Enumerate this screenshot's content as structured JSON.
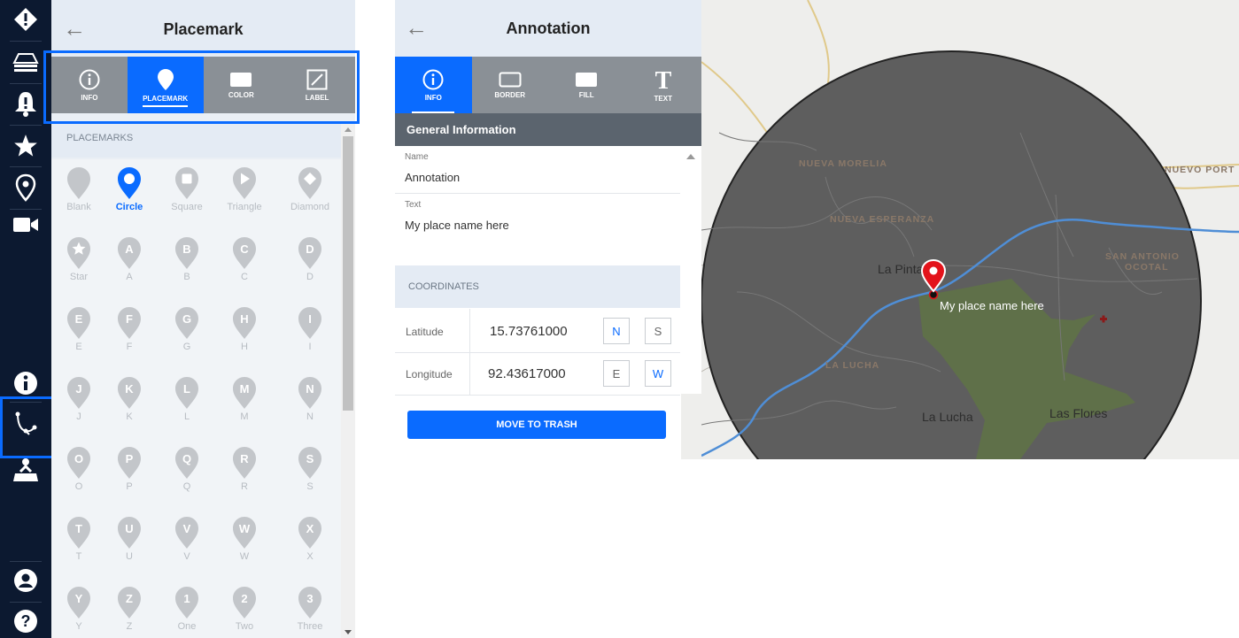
{
  "iconbar": {
    "items": [
      {
        "name": "alert-diamond-icon"
      },
      {
        "name": "layers-icon"
      },
      {
        "name": "bell-alert-icon"
      },
      {
        "name": "star-icon"
      },
      {
        "name": "location-pin-icon"
      },
      {
        "name": "video-camera-icon"
      },
      {
        "name": "info-icon"
      },
      {
        "name": "draw-path-icon",
        "selected": true
      },
      {
        "name": "person-map-icon"
      },
      {
        "name": "user-account-icon"
      },
      {
        "name": "help-icon"
      }
    ]
  },
  "placemark_panel": {
    "title": "Placemark",
    "tabs": [
      {
        "label": "INFO",
        "icon": "info-icon"
      },
      {
        "label": "PLACEMARK",
        "icon": "placemark-icon",
        "active": true
      },
      {
        "label": "COLOR",
        "icon": "color-swatch-icon"
      },
      {
        "label": "LABEL",
        "icon": "label-edit-icon"
      }
    ],
    "list_header": "PLACEMARKS",
    "placemarks": [
      {
        "label": "Blank",
        "glyph": ""
      },
      {
        "label": "Circle",
        "glyph": "",
        "selected": true
      },
      {
        "label": "Square",
        "glyph": ""
      },
      {
        "label": "Triangle",
        "glyph": ""
      },
      {
        "label": "Diamond",
        "glyph": ""
      },
      {
        "label": "Star",
        "glyph": ""
      },
      {
        "label": "A",
        "glyph": "A"
      },
      {
        "label": "B",
        "glyph": "B"
      },
      {
        "label": "C",
        "glyph": "C"
      },
      {
        "label": "D",
        "glyph": "D"
      },
      {
        "label": "E",
        "glyph": "E"
      },
      {
        "label": "F",
        "glyph": "F"
      },
      {
        "label": "G",
        "glyph": "G"
      },
      {
        "label": "H",
        "glyph": "H"
      },
      {
        "label": "I",
        "glyph": "I"
      },
      {
        "label": "J",
        "glyph": "J"
      },
      {
        "label": "K",
        "glyph": "K"
      },
      {
        "label": "L",
        "glyph": "L"
      },
      {
        "label": "M",
        "glyph": "M"
      },
      {
        "label": "N",
        "glyph": "N"
      },
      {
        "label": "O",
        "glyph": "O"
      },
      {
        "label": "P",
        "glyph": "P"
      },
      {
        "label": "Q",
        "glyph": "Q"
      },
      {
        "label": "R",
        "glyph": "R"
      },
      {
        "label": "S",
        "glyph": "S"
      },
      {
        "label": "T",
        "glyph": "T"
      },
      {
        "label": "U",
        "glyph": "U"
      },
      {
        "label": "V",
        "glyph": "V"
      },
      {
        "label": "W",
        "glyph": "W"
      },
      {
        "label": "X",
        "glyph": "X"
      },
      {
        "label": "Y",
        "glyph": "Y"
      },
      {
        "label": "Z",
        "glyph": "Z"
      },
      {
        "label": "One",
        "glyph": "1"
      },
      {
        "label": "Two",
        "glyph": "2"
      },
      {
        "label": "Three",
        "glyph": "3"
      }
    ]
  },
  "annotation_panel": {
    "title": "Annotation",
    "tabs": [
      {
        "label": "INFO",
        "icon": "info-icon",
        "active": true
      },
      {
        "label": "BORDER",
        "icon": "border-rect-icon"
      },
      {
        "label": "FILL",
        "icon": "fill-rect-icon"
      },
      {
        "label": "TEXT",
        "icon": "text-t-icon"
      }
    ],
    "general_header": "General Information",
    "name_label": "Name",
    "name_value": "Annotation",
    "text_label": "Text",
    "text_value": "My place name here",
    "coordinates_header": "COORDINATES",
    "latitude_label": "Latitude",
    "latitude_value": "15.73761000",
    "lat_dirs": [
      "N",
      "S"
    ],
    "longitude_label": "Longitude",
    "longitude_value": "92.43617000",
    "lon_dirs": [
      "E",
      "W"
    ],
    "trash_button": "MOVE TO TRASH"
  },
  "map": {
    "labels": {
      "nueva_morelia": "NUEVA MORELIA",
      "nueva_esperanza": "NUEVA ESPERANZA",
      "nuevo_port": "NUEVO PORT",
      "san_antonio": "SAN ANTONIO",
      "ocotal": "OCOTAL",
      "la_pinta": "La Pinta",
      "la_lucha_caps": "LA LUCHA",
      "la_lucha": "La Lucha",
      "las_flores": "Las Flores"
    },
    "annotation_text": "My place name here",
    "colors": {
      "accent": "#0a6bff",
      "pin": "#e3131b",
      "overlay": "#5e5e5e",
      "green_area": "#5f7049",
      "river": "#4f8ed6"
    }
  }
}
